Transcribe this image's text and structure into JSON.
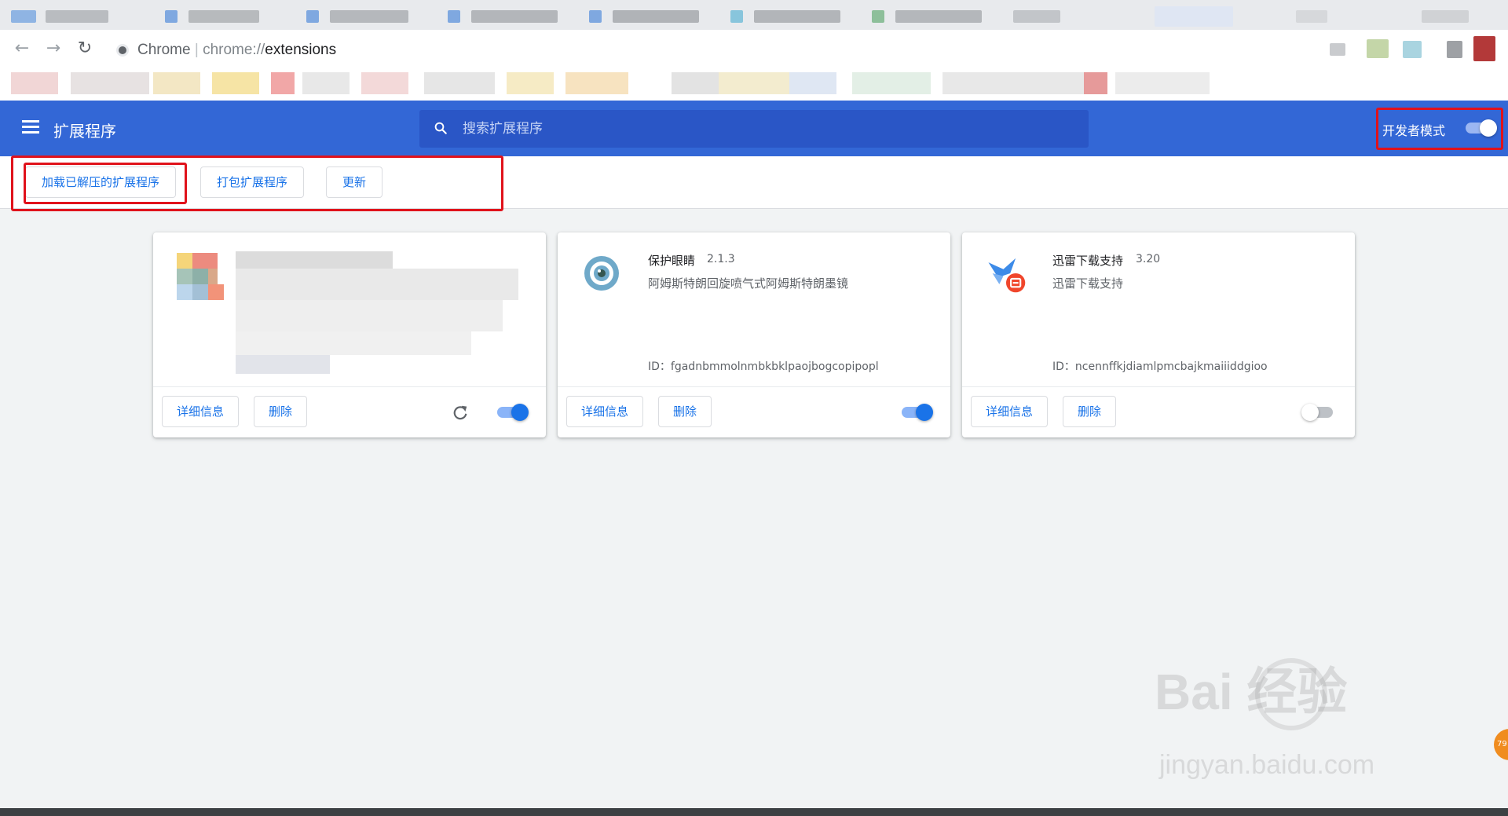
{
  "browser": {
    "app_name": "Chrome",
    "url_scheme": "chrome://",
    "url_host": "extensions",
    "back_icon": "arrow-left-icon",
    "forward_icon": "arrow-right-icon",
    "reload_icon": "reload-icon"
  },
  "header": {
    "title": "扩展程序",
    "search_placeholder": "搜索扩展程序",
    "dev_mode_label": "开发者模式",
    "dev_mode_on": true
  },
  "dev_toolbar": {
    "load_unpacked": "加载已解压的扩展程序",
    "pack": "打包扩展程序",
    "update": "更新"
  },
  "cards": [
    {
      "name": "",
      "version": "",
      "description": "",
      "id_label": "",
      "details_label": "详细信息",
      "remove_label": "删除",
      "enabled": true,
      "blurred": true
    },
    {
      "name": "保护眼睛",
      "version": "2.1.3",
      "description": "阿姆斯特朗回旋喷气式阿姆斯特朗墨镜",
      "id_label": "ID：fgadnbmmolnmbkbklpaojbogcopipopl",
      "details_label": "详细信息",
      "remove_label": "删除",
      "enabled": true
    },
    {
      "name": "迅雷下载支持",
      "version": "3.20",
      "description": "迅雷下载支持",
      "id_label": "ID：ncennffkjdiamlpmcbajkmaiiiddgioo",
      "details_label": "详细信息",
      "remove_label": "删除",
      "enabled": false
    }
  ],
  "watermark": {
    "main": "Bai 经验",
    "sub": "jingyan.baidu.com"
  },
  "badge_text": "79",
  "colors": {
    "header_blue": "#3367d6",
    "accent": "#1a73e8",
    "highlight_red": "#e0121b"
  }
}
